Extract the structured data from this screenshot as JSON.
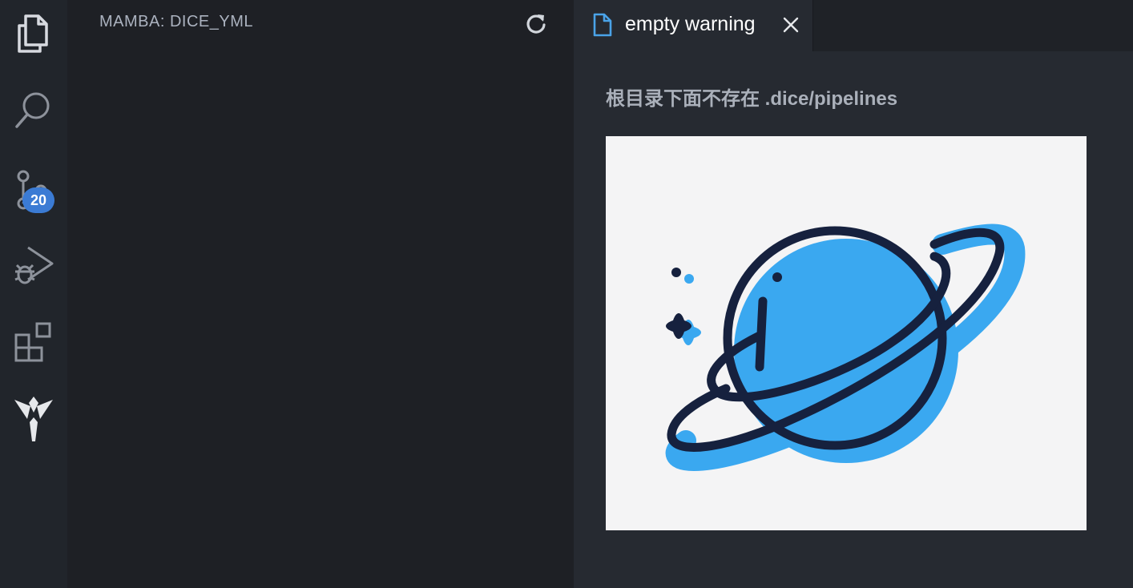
{
  "activity_bar": {
    "items": [
      {
        "icon": "files-icon"
      },
      {
        "icon": "search-icon"
      },
      {
        "icon": "source-control-icon",
        "badge": "20"
      },
      {
        "icon": "run-debug-icon"
      },
      {
        "icon": "extensions-icon"
      },
      {
        "icon": "mamba-logo-icon"
      }
    ]
  },
  "sidebar": {
    "title": "MAMBA: DICE_YML",
    "refresh_icon": "refresh-icon"
  },
  "editor": {
    "tab": {
      "label": "empty warning",
      "icon": "file-icon",
      "close_icon": "close-icon"
    },
    "warning": "根目录下面不存在 .dice/pipelines",
    "illustration": {
      "icon": "planet-illustration",
      "colors": {
        "planet": "#3aa8f0",
        "outline": "#16213e",
        "background": "#f4f4f5"
      }
    }
  },
  "colors": {
    "activity_bar_bg": "#21252b",
    "sidebar_bg": "#1e2025",
    "editor_bg": "#262a31",
    "badge_bg": "#3b7bd4",
    "tab_icon": "#4aa3e8"
  }
}
